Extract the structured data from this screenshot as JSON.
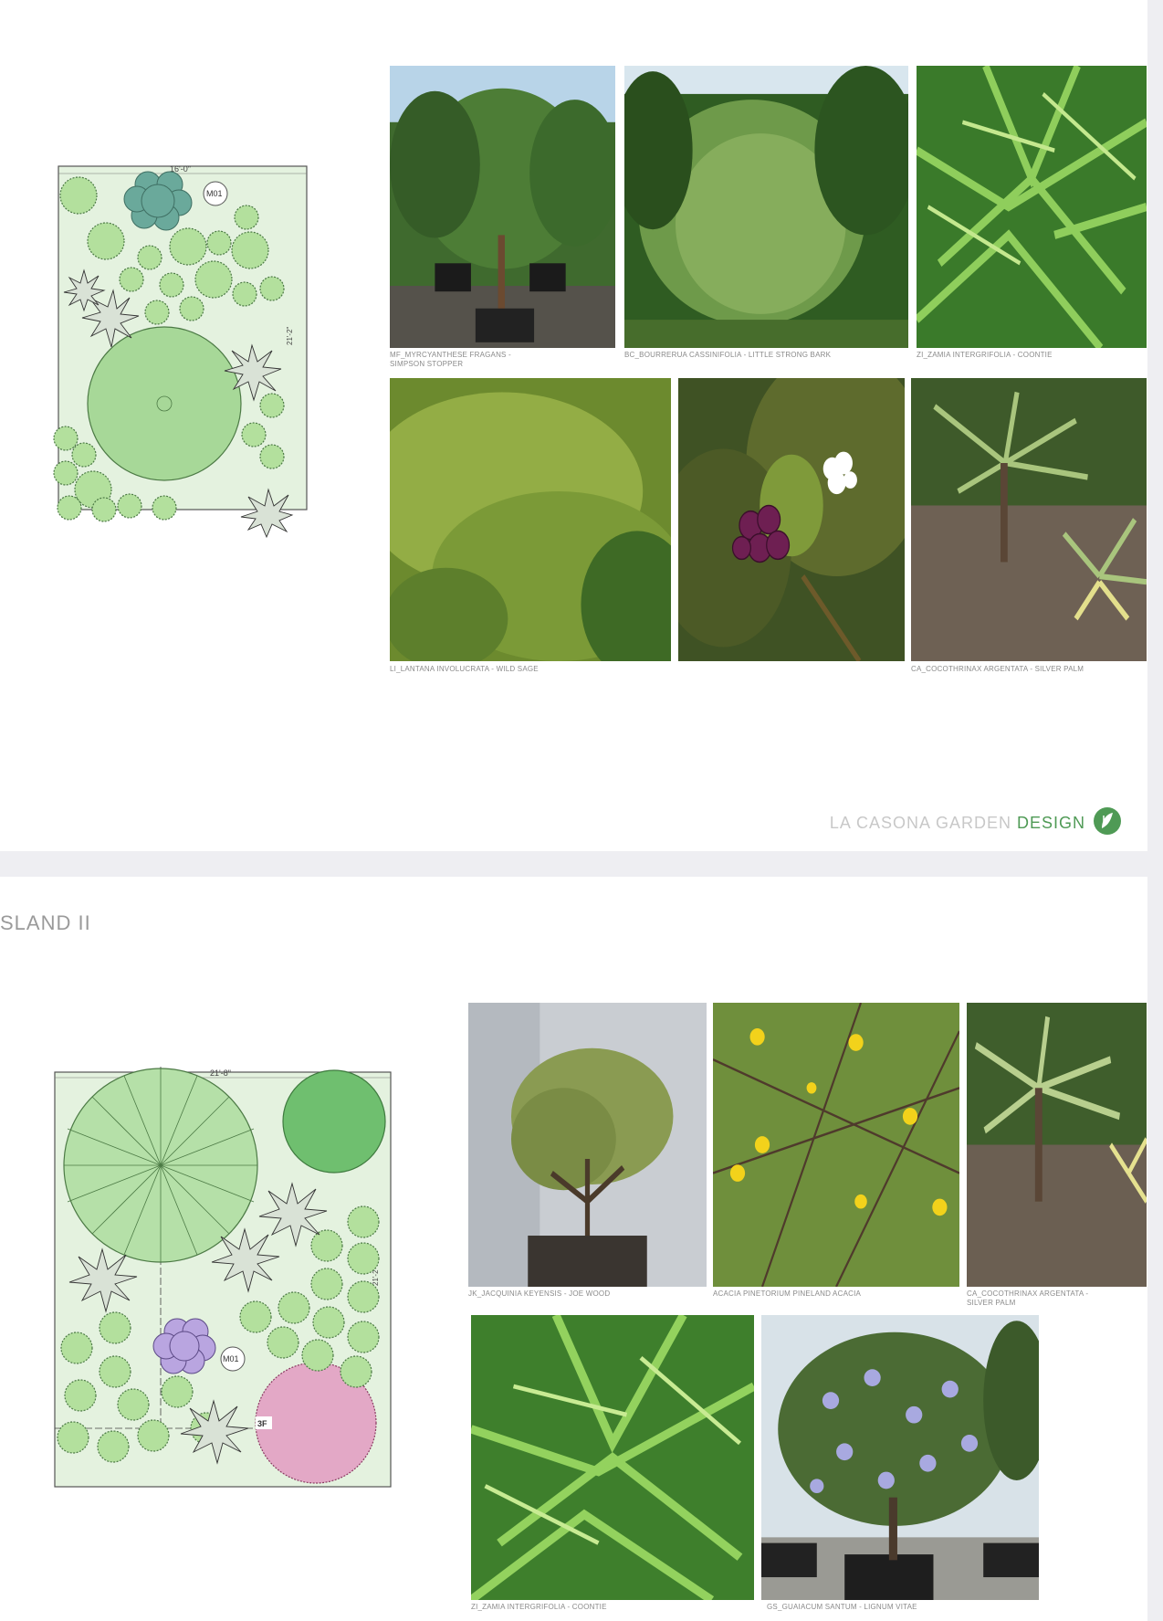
{
  "page1": {
    "plan": {
      "dimension": "16'-0\"",
      "dimension_side": "21'-2\"",
      "marker": "M01"
    },
    "photos": [
      {
        "caption": "MF_MYRCYANTHESE FRAGANS -\nSIMPSON STOPPER"
      },
      {
        "caption": "BC_BOURRERUA CASSINIFOLIA - LITTLE STRONG BARK"
      },
      {
        "caption": "ZI_ZAMIA INTERGRIFOLIA - COONTIE"
      },
      {
        "caption": "LI_LANTANA INVOLUCRATA - WILD SAGE"
      },
      {
        "caption": ""
      },
      {
        "caption": "CA_COCOTHRINAX ARGENTATA - SILVER PALM"
      }
    ],
    "brand": {
      "prefix": "LA CASONA GARDEN ",
      "accent": "DESIGN"
    }
  },
  "page2": {
    "title": "SLAND II",
    "plan": {
      "dimension": "21'-8\"",
      "dimension_side": "21'-2\"",
      "marker": "M01",
      "tag": "3F"
    },
    "photos": [
      {
        "caption": "JK_JACQUINIA KEYENSIS - JOE WOOD"
      },
      {
        "caption": "ACACIA PINETORIUM PINELAND ACACIA"
      },
      {
        "caption": "CA_COCOTHRINAX ARGENTATA -\nSILVER PALM"
      },
      {
        "caption": "ZI_ZAMIA INTERGRIFOLIA - COONTIE"
      },
      {
        "caption": "GS_GUAIACUM SANTUM - LIGNUM VITAE"
      }
    ]
  },
  "colors": {
    "accent": "#4f9a55",
    "plan_bg": "#e4f2df",
    "shrub": "#9fd08a",
    "palm": "#c9d6c8"
  }
}
